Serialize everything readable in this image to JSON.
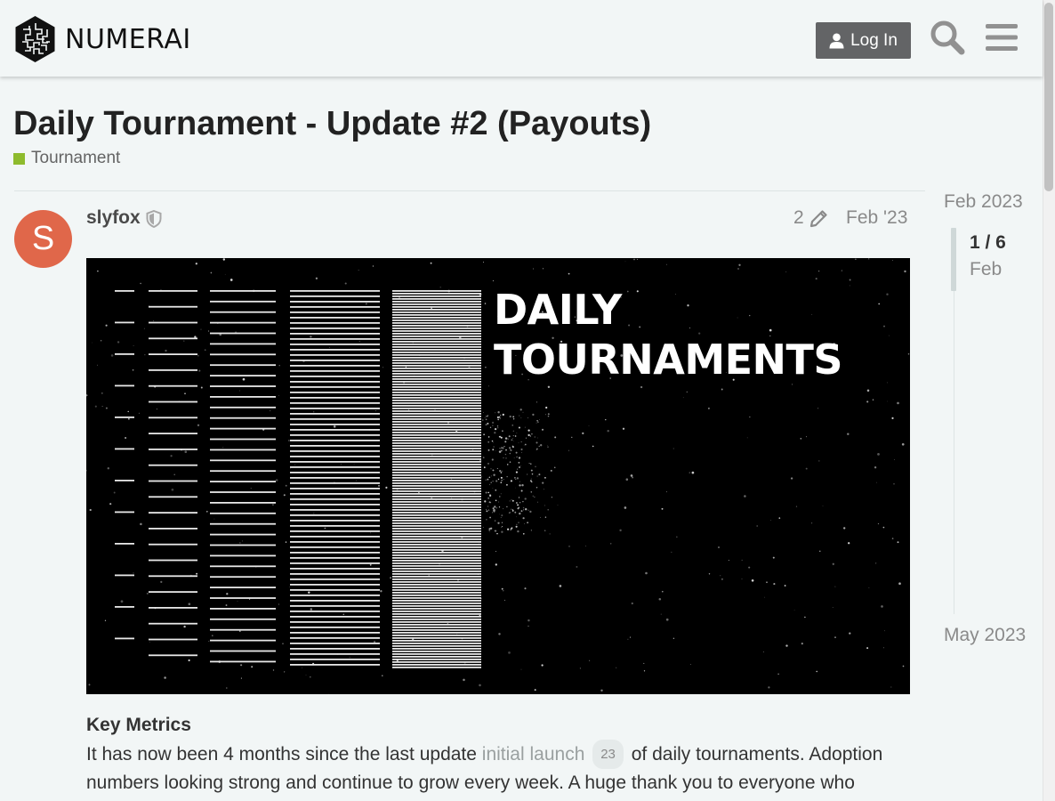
{
  "header": {
    "logo_text": "NUMERAI",
    "login_label": "Log In",
    "search_icon": "search-icon",
    "menu_icon": "hamburger-menu-icon"
  },
  "topic": {
    "title": "Daily Tournament - Update #2 (Payouts)",
    "category": "Tournament",
    "category_color": "#8ebb2d"
  },
  "post": {
    "avatar_letter": "S",
    "avatar_color": "#e0674a",
    "username": "slyfox",
    "edit_count": "2",
    "date": "Feb '23",
    "banner_line1": "DAILY",
    "banner_line2": "TOURNAMENTS",
    "heading": "Key Metrics",
    "text_before_link": "It has now been 4 months since the last update ",
    "link_text": "initial launch",
    "link_clicks": "23",
    "text_after_link": " of daily tournaments. Adoption numbers looking strong and continue to grow every week. A huge thank you to everyone who"
  },
  "timeline": {
    "start": "Feb 2023",
    "position": "1 / 6",
    "month": "Feb",
    "end": "May 2023"
  }
}
